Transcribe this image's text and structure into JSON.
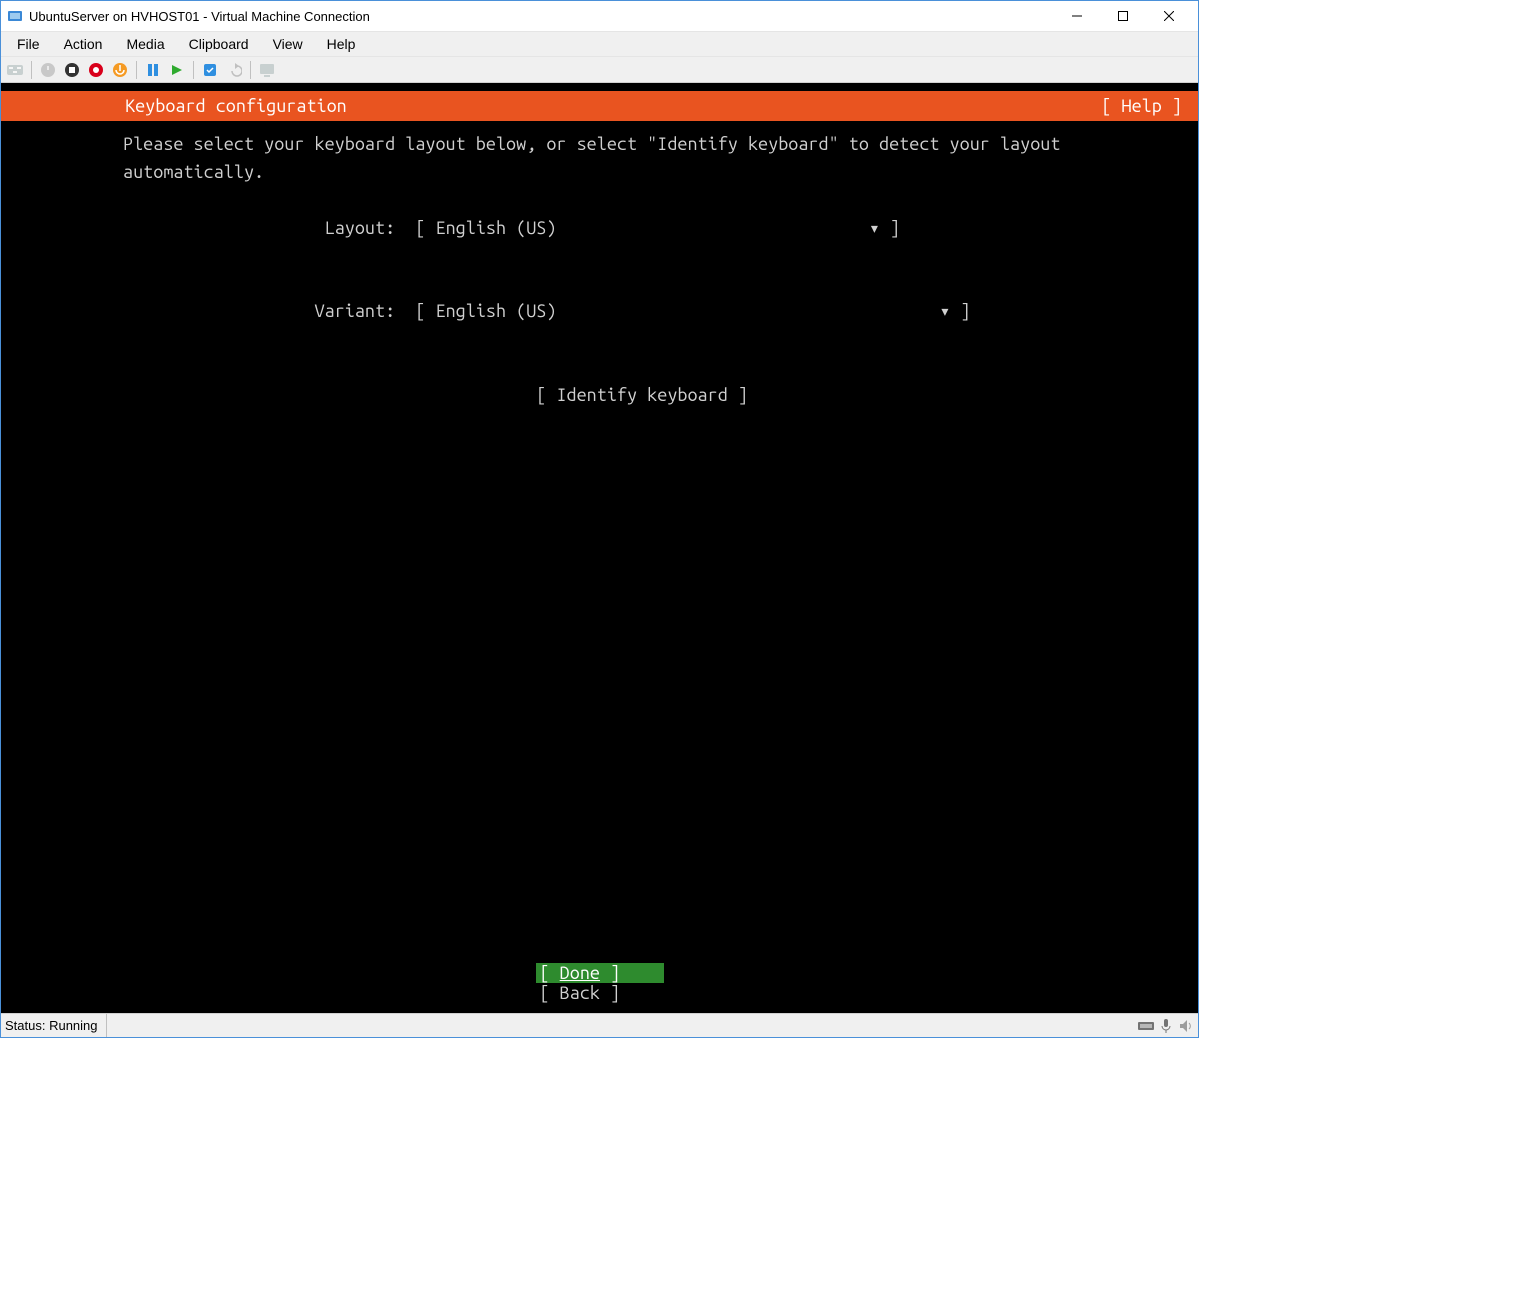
{
  "window": {
    "title": "UbuntuServer on HVHOST01 - Virtual Machine Connection"
  },
  "menubar": {
    "items": [
      "File",
      "Action",
      "Media",
      "Clipboard",
      "View",
      "Help"
    ]
  },
  "toolbar": {
    "icons": [
      "ctrl-alt-del-icon",
      "start-icon",
      "turnoff-icon",
      "shutdown-icon",
      "save-icon",
      "pause-icon",
      "reset-icon",
      "checkpoint-icon",
      "revert-icon",
      "enhanced-session-icon"
    ]
  },
  "installer": {
    "header_title": "Keyboard configuration",
    "header_help": "[ Help ]",
    "instruction": "Please select your keyboard layout below, or select \"Identify keyboard\" to detect your layout\nautomatically.",
    "layout_label": "Layout:",
    "layout_value": "[ English (US)                               ▾ ]",
    "variant_label": "Variant:",
    "variant_value": "[ English (US)                                      ▾ ]",
    "identify": "[ Identify keyboard ]",
    "done_open": "[ ",
    "done_label": "Done",
    "done_close": "         ]",
    "back": "[ Back         ]"
  },
  "statusbar": {
    "text": "Status: Running"
  },
  "colors": {
    "ubuntu_orange": "#e95420",
    "selected_green": "#2e8b2e"
  }
}
